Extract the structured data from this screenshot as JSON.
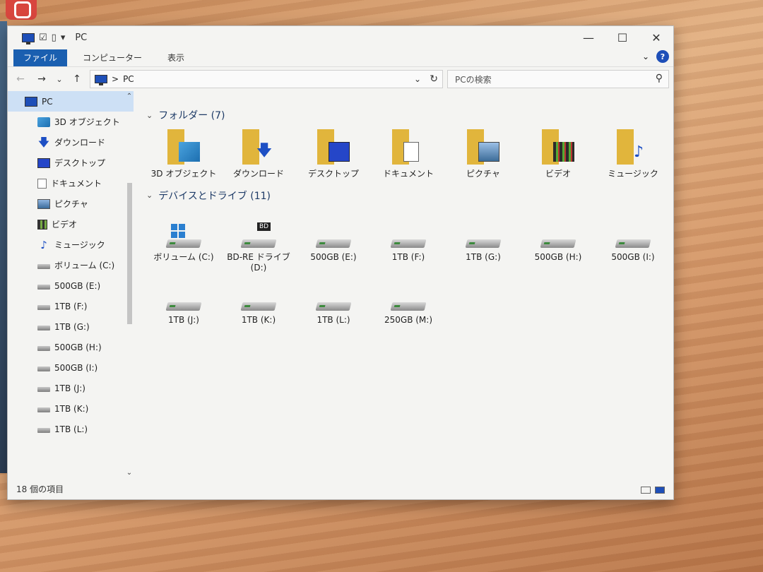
{
  "window": {
    "title": "PC",
    "controls": {
      "minimize": "—",
      "maximize": "☐",
      "close": "✕"
    }
  },
  "ribbon": {
    "tabs": [
      "ファイル",
      "コンピューター",
      "表示"
    ],
    "expand": "⌄",
    "help": "?"
  },
  "nav": {
    "back": "←",
    "forward": "→",
    "recent": "⌄",
    "up": "↑",
    "address_sep": ">",
    "address_location": "PC",
    "address_dropdown": "⌄",
    "refresh": "↻",
    "search_placeholder": "PCの検索",
    "search_icon": "⚲"
  },
  "sidebar": {
    "items": [
      {
        "label": "PC",
        "icon": "pc-icon",
        "selected": true
      },
      {
        "label": "3D オブジェクト",
        "icon": "3d-objects-icon"
      },
      {
        "label": "ダウンロード",
        "icon": "download-icon"
      },
      {
        "label": "デスクトップ",
        "icon": "desktop-icon"
      },
      {
        "label": "ドキュメント",
        "icon": "document-icon"
      },
      {
        "label": "ピクチャ",
        "icon": "picture-icon"
      },
      {
        "label": "ビデオ",
        "icon": "video-icon"
      },
      {
        "label": "ミュージック",
        "icon": "music-icon"
      },
      {
        "label": "ボリューム (C:)",
        "icon": "drive-icon"
      },
      {
        "label": "500GB (E:)",
        "icon": "drive-icon"
      },
      {
        "label": "1TB (F:)",
        "icon": "drive-icon"
      },
      {
        "label": "1TB (G:)",
        "icon": "drive-icon"
      },
      {
        "label": "500GB (H:)",
        "icon": "drive-icon"
      },
      {
        "label": "500GB (I:)",
        "icon": "drive-icon"
      },
      {
        "label": "1TB (J:)",
        "icon": "drive-icon"
      },
      {
        "label": "1TB (K:)",
        "icon": "drive-icon"
      },
      {
        "label": "1TB (L:)",
        "icon": "drive-icon"
      }
    ],
    "scroll_up": "⌃",
    "scroll_down": "⌄"
  },
  "content": {
    "folders_header": "フォルダー (7)",
    "folders": [
      {
        "label": "3D オブジェクト",
        "icon": "3d-objects-icon"
      },
      {
        "label": "ダウンロード",
        "icon": "download-icon"
      },
      {
        "label": "デスクトップ",
        "icon": "desktop-icon"
      },
      {
        "label": "ドキュメント",
        "icon": "document-icon"
      },
      {
        "label": "ピクチャ",
        "icon": "picture-icon"
      },
      {
        "label": "ビデオ",
        "icon": "video-icon"
      },
      {
        "label": "ミュージック",
        "icon": "music-icon"
      }
    ],
    "drives_header": "デバイスとドライブ (11)",
    "drives": [
      {
        "label": "ボリューム (C:)",
        "type": "windows"
      },
      {
        "label": "BD-RE ドライブ (D:)",
        "type": "bd",
        "badge": "BD"
      },
      {
        "label": "500GB (E:)",
        "type": "hdd"
      },
      {
        "label": "1TB (F:)",
        "type": "hdd"
      },
      {
        "label": "1TB (G:)",
        "type": "hdd"
      },
      {
        "label": "500GB (H:)",
        "type": "hdd"
      },
      {
        "label": "500GB (I:)",
        "type": "hdd"
      },
      {
        "label": "1TB (J:)",
        "type": "hdd"
      },
      {
        "label": "1TB (K:)",
        "type": "hdd"
      },
      {
        "label": "1TB (L:)",
        "type": "hdd"
      },
      {
        "label": "250GB (M:)",
        "type": "hdd"
      }
    ]
  },
  "status": {
    "item_count": "18 個の項目"
  },
  "colors": {
    "accent": "#1a5fb0",
    "folder": "#e1b53c",
    "desktop_wood": "#d69a6c"
  }
}
